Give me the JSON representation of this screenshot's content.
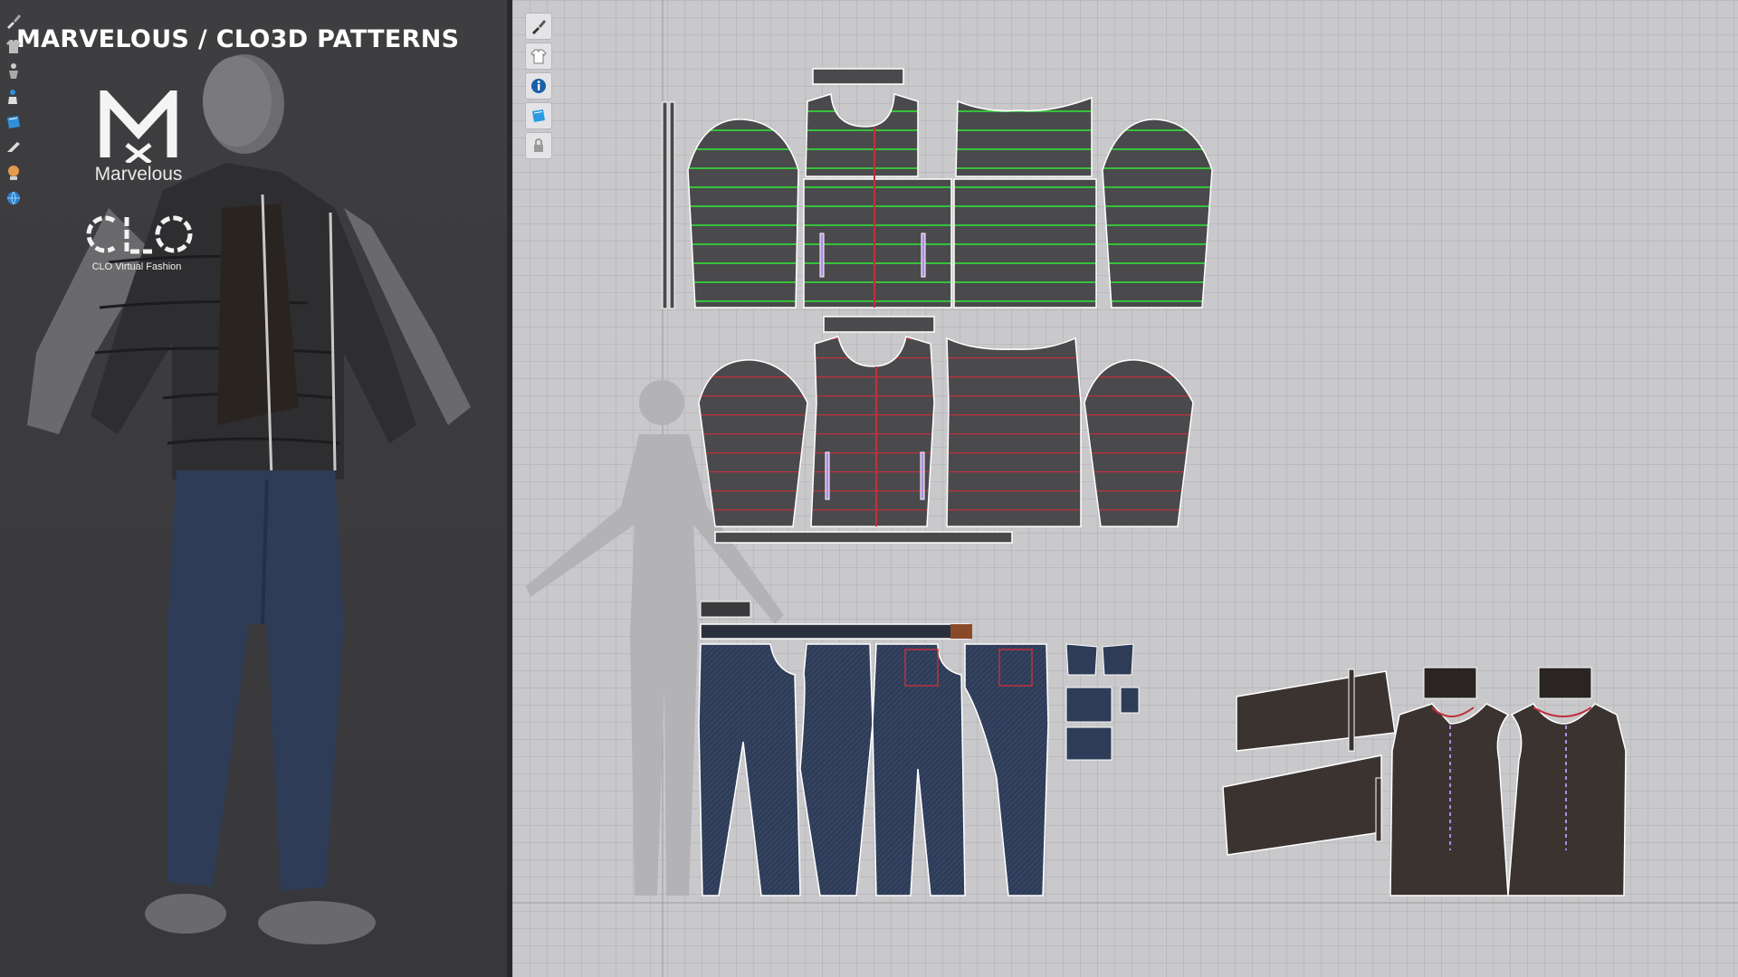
{
  "title": "MARVELOUS / CLO3D PATTERNS",
  "brands": {
    "marvelous": {
      "mark": "M",
      "wordmark": "Marvelous"
    },
    "clo": {
      "mark": "CLO",
      "tagline": "CLO Virtual Fashion"
    }
  },
  "toolbar3d": {
    "items": [
      {
        "icon": "brush-icon"
      },
      {
        "icon": "garment-icon"
      },
      {
        "icon": "avatar-pose-icon"
      },
      {
        "icon": "avatar-icon"
      },
      {
        "icon": "fabric-icon"
      },
      {
        "icon": "iron-icon"
      },
      {
        "icon": "skin-icon"
      },
      {
        "icon": "globe-icon"
      }
    ]
  },
  "toolbar2d": {
    "items": [
      {
        "icon": "brush-icon"
      },
      {
        "icon": "shirt-icon"
      },
      {
        "icon": "info-icon"
      },
      {
        "icon": "fabric-icon"
      },
      {
        "icon": "lock-icon"
      }
    ]
  },
  "colors": {
    "view3d_bg": "#3c3c3f",
    "view2d_bg": "#c9c9cb",
    "jacket_piece": "#4a4a4d",
    "green_line": "#36c23a",
    "red_line": "#c0303a",
    "denim": "#2e3c58",
    "dark_fabric": "#3a3330",
    "white": "#ffffff"
  }
}
